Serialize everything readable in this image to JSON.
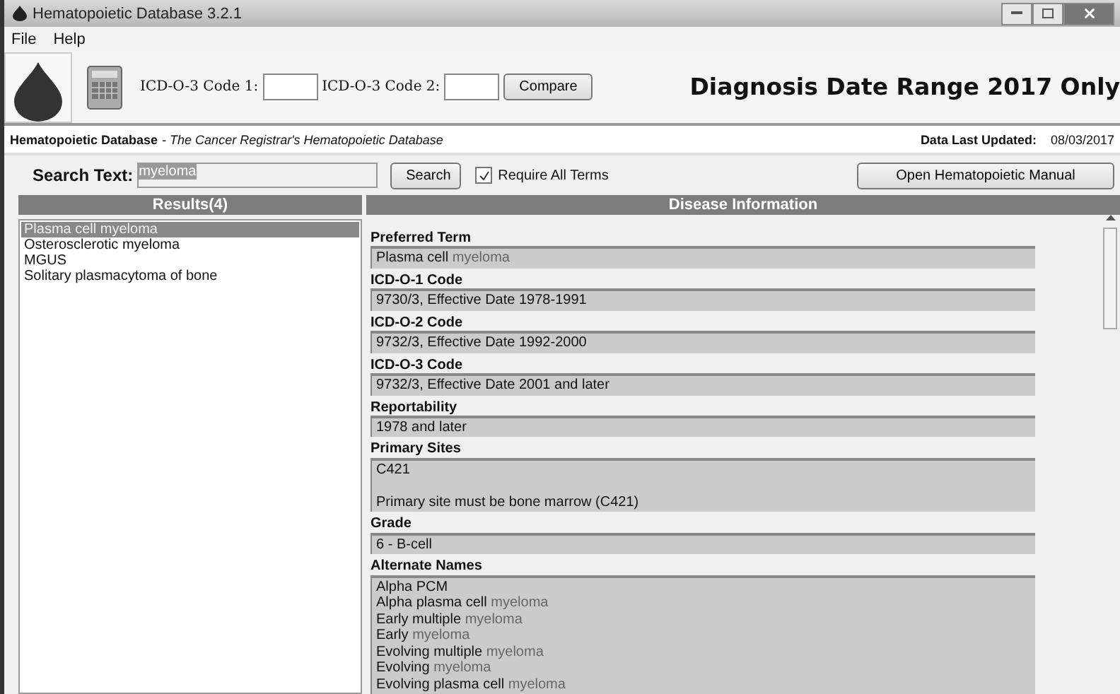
{
  "window": {
    "title": "Hematopoietic Database 3.2.1"
  },
  "menu": [
    "File",
    "Help"
  ],
  "toolbar": {
    "code1_label": "ICD-O-3 Code 1:",
    "code2_label": "ICD-O-3 Code 2:",
    "compare": "Compare",
    "banner": "Diagnosis Date Range 2017 Only"
  },
  "info_bar": {
    "app": "Hematopoietic Database",
    "subtitle": "- The Cancer Registrar's Hematopoietic Database",
    "updated_label": "Data Last Updated:",
    "updated": "08/03/2017"
  },
  "search": {
    "label": "Search Text:",
    "value": "myeloma",
    "button": "Search",
    "require_all": {
      "label": "Require All Terms",
      "checked": true
    },
    "manual": "Open Hematopoietic Manual"
  },
  "results": {
    "title": "Results(4)",
    "items": [
      {
        "label": "Plasma cell myeloma",
        "selected": true
      },
      {
        "label": "Osterosclerotic myeloma",
        "selected": false
      },
      {
        "label": "MGUS",
        "selected": false
      },
      {
        "label": "Solitary plasmacytoma of bone",
        "selected": false
      }
    ]
  },
  "disease": {
    "title": "Disease Information",
    "fields": [
      {
        "label": "Preferred Term",
        "lines": [
          [
            {
              "text": "Plasma cell ",
              "match": false
            },
            {
              "text": "myeloma",
              "match": true
            }
          ]
        ]
      },
      {
        "label": "ICD-O-1 Code",
        "lines": [
          [
            {
              "text": "9730/3, Effective Date 1978-1991",
              "match": false
            }
          ]
        ]
      },
      {
        "label": "ICD-O-2 Code",
        "lines": [
          [
            {
              "text": "9732/3, Effective Date 1992-2000",
              "match": false
            }
          ]
        ]
      },
      {
        "label": "ICD-O-3 Code",
        "lines": [
          [
            {
              "text": "9732/3, Effective Date 2001 and later",
              "match": false
            }
          ]
        ]
      },
      {
        "label": "Reportability",
        "lines": [
          [
            {
              "text": "1978 and later",
              "match": false
            }
          ]
        ]
      },
      {
        "label": "Primary Sites",
        "lines": [
          [
            {
              "text": "C421",
              "match": false
            }
          ],
          [
            {
              "text": "Primary site must be bone marrow (C421)",
              "match": false,
              "spaced": true
            }
          ]
        ]
      },
      {
        "label": "Grade",
        "lines": [
          [
            {
              "text": "6 - B-cell",
              "match": false
            }
          ]
        ]
      },
      {
        "label": "Alternate Names",
        "lines": [
          [
            {
              "text": "Alpha PCM",
              "match": false
            }
          ],
          [
            {
              "text": "Alpha plasma cell ",
              "match": false
            },
            {
              "text": "myeloma",
              "match": true
            }
          ],
          [
            {
              "text": "Early multiple ",
              "match": false
            },
            {
              "text": "myeloma",
              "match": true
            }
          ],
          [
            {
              "text": "Early ",
              "match": false
            },
            {
              "text": "myeloma",
              "match": true
            }
          ],
          [
            {
              "text": "Evolving multiple ",
              "match": false
            },
            {
              "text": "myeloma",
              "match": true
            }
          ],
          [
            {
              "text": "Evolving ",
              "match": false
            },
            {
              "text": "myeloma",
              "match": true
            }
          ],
          [
            {
              "text": "Evolving plasma cell ",
              "match": false
            },
            {
              "text": "myeloma",
              "match": true
            }
          ]
        ]
      }
    ]
  }
}
